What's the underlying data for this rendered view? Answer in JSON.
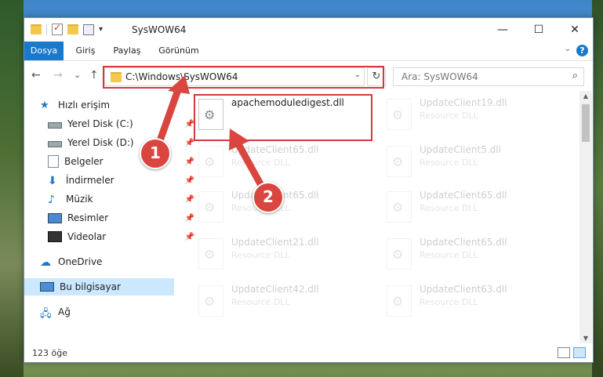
{
  "window": {
    "title": "SysWOW64"
  },
  "ribbon": {
    "tabs": [
      "Dosya",
      "Giriş",
      "Paylaş",
      "Görünüm"
    ],
    "help": "?"
  },
  "nav": {
    "back": "←",
    "forward": "→",
    "recent": "⌄",
    "up": "↑"
  },
  "address": {
    "path": "C:\\Windows\\SysWOW64",
    "refresh": "↻"
  },
  "search": {
    "placeholder": "Ara: SysWOW64"
  },
  "sidebar": {
    "items": [
      {
        "label": "Hızlı erişim",
        "icon": "star-icon",
        "pinned": false
      },
      {
        "label": "Yerel Disk (C:)",
        "icon": "drive-icon",
        "pinned": true
      },
      {
        "label": "Yerel Disk (D:)",
        "icon": "drive-icon",
        "pinned": true
      },
      {
        "label": "Belgeler",
        "icon": "documents-icon",
        "pinned": true
      },
      {
        "label": "İndirmeler",
        "icon": "download-icon",
        "pinned": true
      },
      {
        "label": "Müzik",
        "icon": "music-icon",
        "pinned": true
      },
      {
        "label": "Resimler",
        "icon": "pictures-icon",
        "pinned": true
      },
      {
        "label": "Videolar",
        "icon": "videos-icon",
        "pinned": true
      },
      {
        "label": "OneDrive",
        "icon": "cloud-icon",
        "pinned": false
      },
      {
        "label": "Bu bilgisayar",
        "icon": "computer-icon",
        "pinned": false
      },
      {
        "label": "Ağ",
        "icon": "network-icon",
        "pinned": false
      }
    ]
  },
  "files": {
    "highlighted": {
      "name": "apachemoduledigest.dll"
    },
    "faded": [
      {
        "name": "UpdateClient19.dll",
        "desc": "Resource DLL"
      },
      {
        "name": "UpdateClient65.dll",
        "desc": "Resource DLL"
      },
      {
        "name": "UpdateClient5.dll",
        "desc": "Resource DLL"
      },
      {
        "name": "UpdateClient65.dll",
        "desc": "Resource DLL"
      },
      {
        "name": "UpdateClient65.dll",
        "desc": "Resource DLL"
      },
      {
        "name": "UpdateClient21.dll",
        "desc": "Resource DLL"
      },
      {
        "name": "UpdateClient65.dll",
        "desc": "Resource DLL"
      },
      {
        "name": "UpdateClient42.dll",
        "desc": "Resource DLL"
      },
      {
        "name": "UpdateClient63.dll",
        "desc": "Resource DLL"
      }
    ]
  },
  "status": {
    "count": "123 öğe"
  },
  "annotations": {
    "badge1": "1",
    "badge2": "2",
    "color": "#d9463f"
  }
}
